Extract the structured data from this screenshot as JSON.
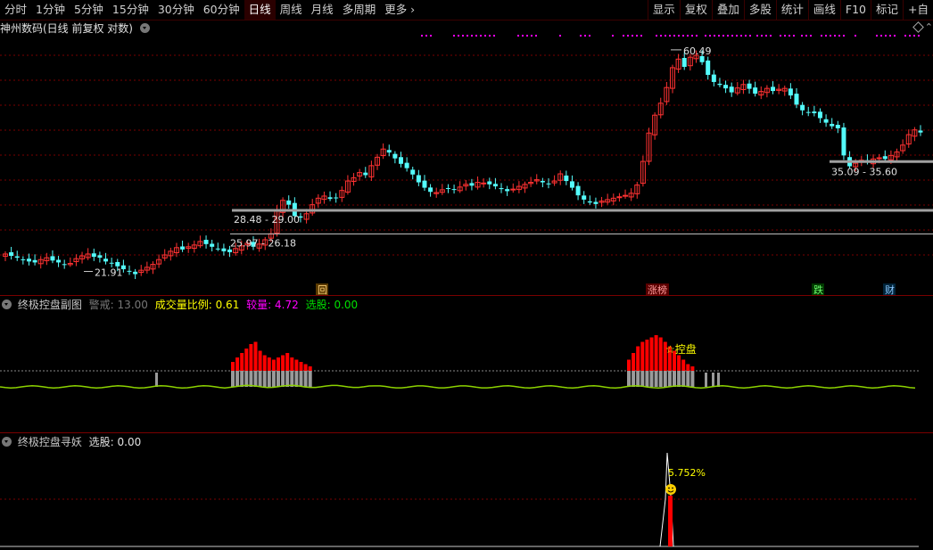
{
  "toolbar": {
    "periods": [
      "分时",
      "1分钟",
      "5分钟",
      "15分钟",
      "30分钟",
      "60分钟",
      "日线",
      "周线",
      "月线",
      "多周期",
      "更多"
    ],
    "active": "日线",
    "actions": [
      "显示",
      "复权",
      "叠加",
      "多股",
      "统计",
      "画线",
      "F10",
      "标记",
      "+自"
    ]
  },
  "main_panel": {
    "title": "神州数码(日线 前复权 对数)",
    "markers": {
      "hui": "回",
      "zhangbang": "涨榜",
      "die": "跌",
      "cai": "财"
    },
    "right_icons": [
      "diamond-icon",
      "chevron-up-icon"
    ]
  },
  "sub_panel": {
    "name": "终极控盘副图",
    "warn_label": "警戒:",
    "warn_value": "13.00",
    "ratio_label": "成交量比例:",
    "ratio_value": "0.61",
    "volume_label": "较量:",
    "volume_value": "4.72",
    "select_label": "选股:",
    "select_value": "0.00",
    "annotation": "☆控盘"
  },
  "bottom_panel": {
    "name": "终极控盘寻妖",
    "select_label": "选股:",
    "select_value": "0.00",
    "peak_label": "5.752%"
  },
  "colors": {
    "up": "#ff3232",
    "down": "#54fcfc",
    "grid": "#7a0000",
    "magenta": "#ff00ff",
    "yellow": "#ffff00",
    "gray_bar": "#9a9a9a",
    "red_bar": "#ff0000",
    "line_green": "#8cd200"
  },
  "chart_data": [
    {
      "type": "candlestick",
      "title": "神州数码(日线 前复权 对数)",
      "scale": "log",
      "price_labels": [
        "60.49",
        "35.09 - 35.60",
        "28.48 - 29.00",
        "25.97 - 26.18",
        "21.91"
      ],
      "high": 60.49,
      "low": 21.91,
      "zones": [
        {
          "label": "28.48 - 29.00",
          "low": 28.48,
          "high": 29.0
        },
        {
          "label": "25.97 - 26.18",
          "low": 25.97,
          "high": 26.18
        },
        {
          "label": "35.09 - 35.60",
          "low": 35.09,
          "high": 35.6
        }
      ],
      "close_series": [
        24,
        23.8,
        23.6,
        23.4,
        23.2,
        23.1,
        23.4,
        23.6,
        23.3,
        23.1,
        22.9,
        23.0,
        23.5,
        23.8,
        24.0,
        23.7,
        23.6,
        23.2,
        23.0,
        22.7,
        22.4,
        22.2,
        21.91,
        22.3,
        22.6,
        22.9,
        23.4,
        23.9,
        24.3,
        24.7,
        24.5,
        24.8,
        25.0,
        25.4,
        25.1,
        24.8,
        24.6,
        24.3,
        24.2,
        24.6,
        24.9,
        25.2,
        24.8,
        25.1,
        25.6,
        26.3,
        29.2,
        30.6,
        30.0,
        28.5,
        28.3,
        28.8,
        30.0,
        30.9,
        31.2,
        30.8,
        30.9,
        32.0,
        33.4,
        33.9,
        34.7,
        34.3,
        35.8,
        37.2,
        38.6,
        38.0,
        37.0,
        36.1,
        35.4,
        34.4,
        33.2,
        32.4,
        31.8,
        31.7,
        32.1,
        32.3,
        32.2,
        32.5,
        32.9,
        32.7,
        33.2,
        33.1,
        32.9,
        32.6,
        32.2,
        31.9,
        32.2,
        32.6,
        32.9,
        33.2,
        33.6,
        33.2,
        32.9,
        33.4,
        34.5,
        33.4,
        32.4,
        31.3,
        30.7,
        30.3,
        30.1,
        30.5,
        30.7,
        30.9,
        31.1,
        31.3,
        31.6,
        32.8,
        36.5,
        41.5,
        45.0,
        47.5,
        51.0,
        55.8,
        58.0,
        56.0,
        58.5,
        59.0,
        57.2,
        54.0,
        52.3,
        51.6,
        50.8,
        49.9,
        50.9,
        51.7,
        50.7,
        49.6,
        50.1,
        50.8,
        50.2,
        50.6,
        50.8,
        49.2,
        47.2,
        46.0,
        45.6,
        45.4,
        44.4,
        43.5,
        42.8,
        42.4,
        37.5,
        35.7,
        36.2,
        36.7,
        36.4,
        36.9,
        37.1,
        36.9,
        37.5,
        38.1,
        39.3,
        41.2,
        42.1,
        41.6
      ]
    },
    {
      "type": "bar",
      "title": "终极控盘副图",
      "series": [
        {
          "name": "成交量比例",
          "color": "#8cd200",
          "line_level": "low"
        },
        {
          "name": "较量",
          "color": "#ff00ff"
        }
      ],
      "red_bar_groups": [
        {
          "range": [
            30,
            47
          ],
          "values": [
            4,
            6,
            8,
            10,
            12,
            13,
            9,
            7,
            6,
            5,
            6,
            7,
            8,
            6,
            5,
            4,
            3,
            2
          ]
        },
        {
          "range": [
            82,
            96
          ],
          "values": [
            5,
            8,
            11,
            13,
            14,
            15,
            16,
            15,
            13,
            11,
            9,
            7,
            5,
            3,
            2
          ]
        }
      ],
      "threshold_label": "警戒: 13.00"
    },
    {
      "type": "line",
      "title": "终极控盘寻妖",
      "peak_label": "5.752%",
      "peak_index": 86
    }
  ]
}
